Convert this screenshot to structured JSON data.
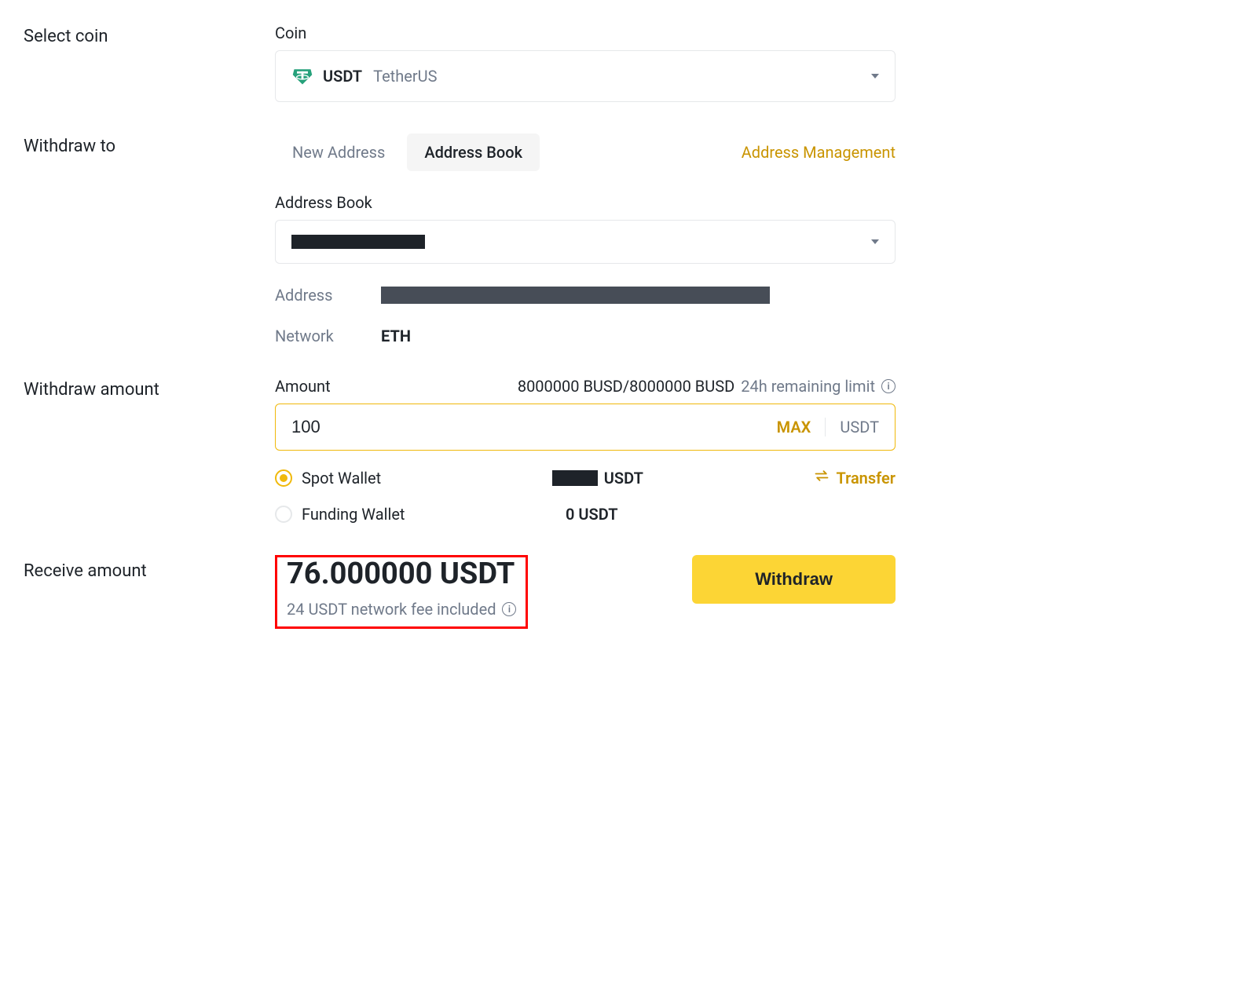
{
  "sections": {
    "select_coin": "Select coin",
    "withdraw_to": "Withdraw to",
    "withdraw_amount": "Withdraw amount",
    "receive_amount": "Receive amount"
  },
  "coin": {
    "label": "Coin",
    "symbol": "USDT",
    "name": "TetherUS"
  },
  "withdraw_to": {
    "tab_new_address": "New Address",
    "tab_address_book": "Address Book",
    "address_management": "Address Management",
    "address_book_label": "Address Book",
    "address_label": "Address",
    "network_label": "Network",
    "network_value": "ETH"
  },
  "amount": {
    "label": "Amount",
    "limit_value": "8000000 BUSD/8000000 BUSD",
    "limit_label": "24h remaining limit",
    "value": "100",
    "max": "MAX",
    "unit": "USDT",
    "wallets": {
      "spot": {
        "name": "Spot Wallet",
        "unit": "USDT"
      },
      "funding": {
        "name": "Funding Wallet",
        "balance": "0 USDT"
      }
    },
    "transfer": "Transfer"
  },
  "receive": {
    "amount": "76.000000 USDT",
    "fee_note": "24 USDT network fee included"
  },
  "actions": {
    "withdraw": "Withdraw"
  }
}
